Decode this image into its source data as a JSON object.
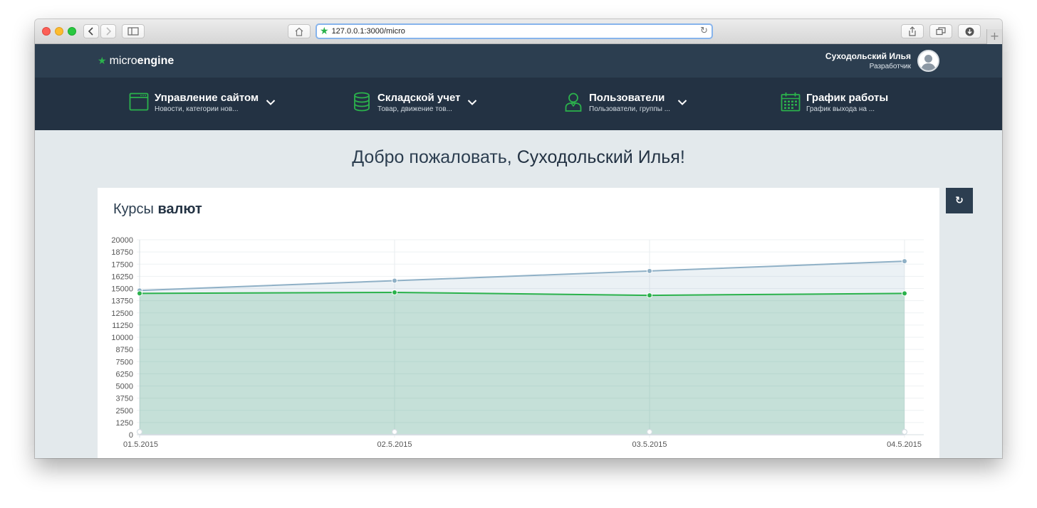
{
  "browser": {
    "url": "127.0.0.1:3000/micro",
    "back_icon": "chevron-left-icon",
    "forward_icon": "chevron-right-icon"
  },
  "brand": {
    "light": "micro",
    "bold": "engine"
  },
  "user": {
    "name": "Суходольский Илья",
    "role": "Разработчик"
  },
  "nav": [
    {
      "title": "Управление сайтом",
      "subtitle": "Новости, категории нов...",
      "icon": "browser-window-icon",
      "has_dropdown": true
    },
    {
      "title": "Складской учет",
      "subtitle": "Товар, движение тов...",
      "icon": "database-icon",
      "has_dropdown": true
    },
    {
      "title": "Пользователи",
      "subtitle": "Пользователи, группы ...",
      "icon": "user-icon",
      "has_dropdown": true
    },
    {
      "title": "График работы",
      "subtitle": "График выхода на ...",
      "icon": "calendar-icon",
      "has_dropdown": false
    }
  ],
  "welcome": {
    "prefix": "Добро пожаловать, ",
    "name": "Суходольский Илья",
    "suffix": "!"
  },
  "card": {
    "title_light": "Курсы",
    "title_bold": "валют",
    "refresh_icon": "refresh-icon"
  },
  "colors": {
    "accent": "#2bb24c",
    "header": "#2c3e50",
    "nav": "#233243",
    "series_blue": "#8fb0c6",
    "series_green": "#2bb24c"
  },
  "chart_data": {
    "type": "area",
    "x": [
      "01.5.2015",
      "02.5.2015",
      "03.5.2015",
      "04.5.2015"
    ],
    "ylim": [
      0,
      20000
    ],
    "y_ticks": [
      0,
      1250,
      2500,
      3750,
      5000,
      6250,
      7500,
      8750,
      10000,
      11250,
      12500,
      13750,
      15000,
      16250,
      17500,
      18750,
      20000
    ],
    "grid": true,
    "series": [
      {
        "values": [
          14800,
          15800,
          16800,
          17800
        ],
        "color": "#8fb0c6"
      },
      {
        "values": [
          14500,
          14600,
          14300,
          14500
        ],
        "color": "#2bb24c"
      },
      {
        "values": [
          0,
          0,
          0,
          0
        ],
        "color": "#d5dde2"
      }
    ]
  }
}
